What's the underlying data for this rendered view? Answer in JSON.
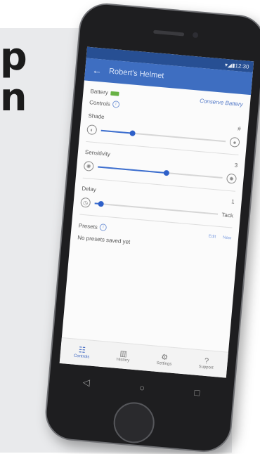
{
  "background": {
    "letters": [
      "p",
      "n"
    ]
  },
  "phone": {
    "status": {
      "time": "12:30"
    },
    "appbar": {
      "back_icon": "←",
      "title": "Robert's Helmet"
    },
    "battery": {
      "label": "Battery",
      "action": "Conserve Battery"
    },
    "controls": {
      "title": "Controls"
    },
    "shade": {
      "label": "Shade",
      "value_label": "#",
      "level": 0.25
    },
    "sensitivity": {
      "label": "Sensitivity",
      "value_label": "3",
      "level": 0.55
    },
    "delay": {
      "label": "Delay",
      "value_label": "1",
      "side_label": "Tack",
      "level": 0.05
    },
    "presets": {
      "title": "Presets",
      "edit": "Edit",
      "new": "New",
      "empty": "No presets saved yet"
    },
    "nav": {
      "items": [
        {
          "label": "Controls",
          "icon": "sliders-icon"
        },
        {
          "label": "History",
          "icon": "bar-chart-icon"
        },
        {
          "label": "Settings",
          "icon": "gear-icon"
        },
        {
          "label": "Support",
          "icon": "help-icon"
        }
      ]
    },
    "sys": {
      "back": "◁",
      "home": "○",
      "recent": "□"
    }
  }
}
